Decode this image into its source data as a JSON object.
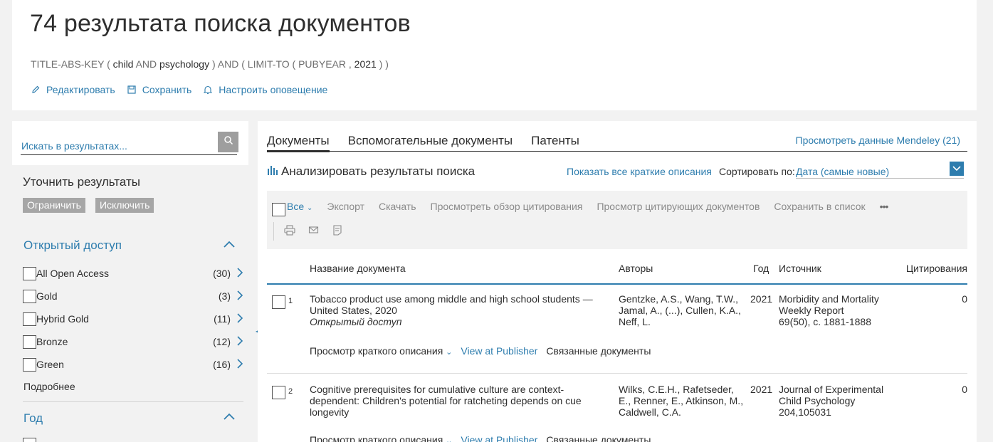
{
  "header": {
    "title": "74 результата поиска документов",
    "query": {
      "field": "TITLE-ABS-KEY",
      "open1": "(",
      "term1": "child",
      "op1": "AND",
      "term2": "psychology",
      "close1": ")",
      "op2": "AND",
      "limit": "( LIMIT-TO ( PUBYEAR ,",
      "year": "2021",
      "close2": ") )"
    },
    "actions": [
      {
        "label": "Редактировать",
        "icon": "pencil-icon"
      },
      {
        "label": "Сохранить",
        "icon": "save-icon"
      },
      {
        "label": "Настроить оповещение",
        "icon": "bell-icon"
      }
    ]
  },
  "sidebar": {
    "search_placeholder": "Искать в результатах...",
    "refine_title": "Уточнить результаты",
    "limit_label": "Ограничить",
    "exclude_label": "Исключить",
    "open_access": {
      "heading": "Открытый доступ",
      "items": [
        {
          "label": "All Open Access",
          "count": "(30)"
        },
        {
          "label": "Gold",
          "count": "(3)"
        },
        {
          "label": "Hybrid Gold",
          "count": "(11)"
        },
        {
          "label": "Bronze",
          "count": "(12)"
        },
        {
          "label": "Green",
          "count": "(16)"
        }
      ],
      "more": "Подробнее"
    },
    "year": {
      "heading": "Год"
    }
  },
  "main": {
    "tabs": [
      {
        "label": "Документы",
        "active": true
      },
      {
        "label": "Вспомогательные документы",
        "active": false
      },
      {
        "label": "Патенты",
        "active": false
      }
    ],
    "mendeley": "Просмотреть данные Mendeley (21)",
    "analyze": "Анализировать результаты поиска",
    "show_abstracts": "Показать все краткие описания",
    "sort_label": "Сортировать по:",
    "sort_value": "Дата (самые новые)",
    "toolbar": {
      "all": "Все",
      "items": [
        "Экспорт",
        "Скачать",
        "Просмотреть обзор цитирования",
        "Просмотр цитирующих документов",
        "Сохранить в список"
      ],
      "more": "•••"
    },
    "table": {
      "headers": {
        "title": "Название документа",
        "authors": "Авторы",
        "year": "Год",
        "source": "Источник",
        "cites": "Цитирования"
      },
      "rows": [
        {
          "num": "1",
          "title": "Tobacco product use among middle and high school students — United States, 2020",
          "open_access": "Открытый доступ",
          "authors": "Gentzke, A.S., Wang, T.W., Jamal, A., (...), Cullen, K.A., Neff, L.",
          "year": "2021",
          "source_name": "Morbidity and Mortality Weekly Report",
          "source_detail": "69(50), с. 1881-1888",
          "cites": "0",
          "abstract_link": "Просмотр краткого описания",
          "publisher_link": "View at Publisher",
          "related_link": "Связанные документы"
        },
        {
          "num": "2",
          "title": "Cognitive prerequisites for cumulative culture are context-dependent: Children's potential for ratcheting depends on cue longevity",
          "open_access": "",
          "authors": "Wilks, C.E.H., Rafetseder, E., Renner, E., Atkinson, M., Caldwell, C.A.",
          "year": "2021",
          "source_name": "Journal of Experimental Child Psychology",
          "source_detail": "204,105031",
          "cites": "0",
          "abstract_link": "Просмотр краткого описания",
          "publisher_link": "View at Publisher",
          "related_link": "Связанные документы"
        }
      ]
    }
  },
  "colors": {
    "accent": "#2e7dae",
    "text": "#2e2e2e",
    "muted": "#8a8a8a",
    "background": "#f2f2f2"
  }
}
